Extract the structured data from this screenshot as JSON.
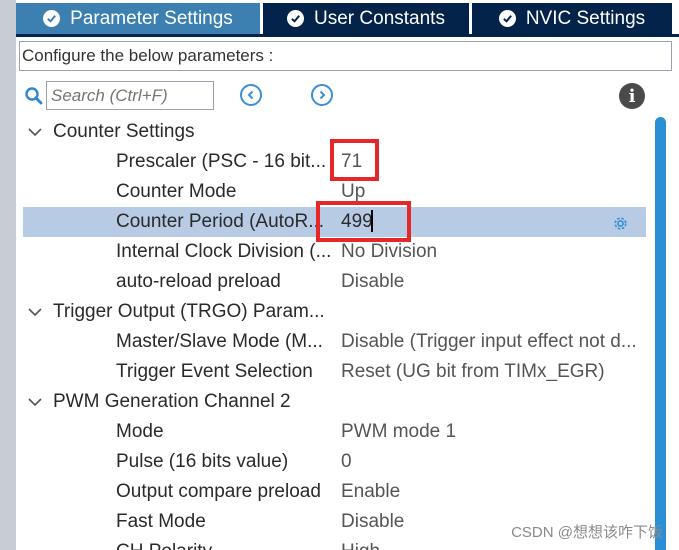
{
  "tabs": [
    {
      "label": "Parameter Settings",
      "active": true
    },
    {
      "label": "User Constants",
      "active": false
    },
    {
      "label": "NVIC Settings",
      "active": false
    }
  ],
  "description": "Configure the below parameters :",
  "search": {
    "placeholder": "Search (Ctrl+F)",
    "value": ""
  },
  "tree": {
    "counter_settings": {
      "label": "Counter Settings",
      "rows": [
        {
          "label": "Prescaler (PSC - 16 bit...",
          "value": "71"
        },
        {
          "label": "Counter Mode",
          "value": "Up"
        },
        {
          "label": "Counter Period (AutoR...",
          "value": "499"
        },
        {
          "label": "Internal Clock Division (...",
          "value": "No Division"
        },
        {
          "label": "auto-reload preload",
          "value": "Disable"
        }
      ]
    },
    "trigger_output": {
      "label": "Trigger Output (TRGO) Param...",
      "rows": [
        {
          "label": "Master/Slave Mode (M...",
          "value": "Disable (Trigger input effect not d..."
        },
        {
          "label": "Trigger Event Selection",
          "value": "Reset (UG bit from TIMx_EGR)"
        }
      ]
    },
    "pwm_channel_2": {
      "label": "PWM Generation Channel 2",
      "rows": [
        {
          "label": "Mode",
          "value": "PWM mode 1"
        },
        {
          "label": "Pulse (16 bits value)",
          "value": "0"
        },
        {
          "label": "Output compare preload",
          "value": "Enable"
        },
        {
          "label": "Fast Mode",
          "value": "Disable"
        },
        {
          "label": "CH Polarity",
          "value": "High"
        }
      ]
    }
  },
  "watermark": "CSDN @想想该咋下饭",
  "colors": {
    "tab_active": "#3c7fb1",
    "tab_inactive": "#03234b",
    "selection": "#b7cbe4",
    "highlight": "#e52727",
    "scrollbar": "#2a8fd6"
  }
}
